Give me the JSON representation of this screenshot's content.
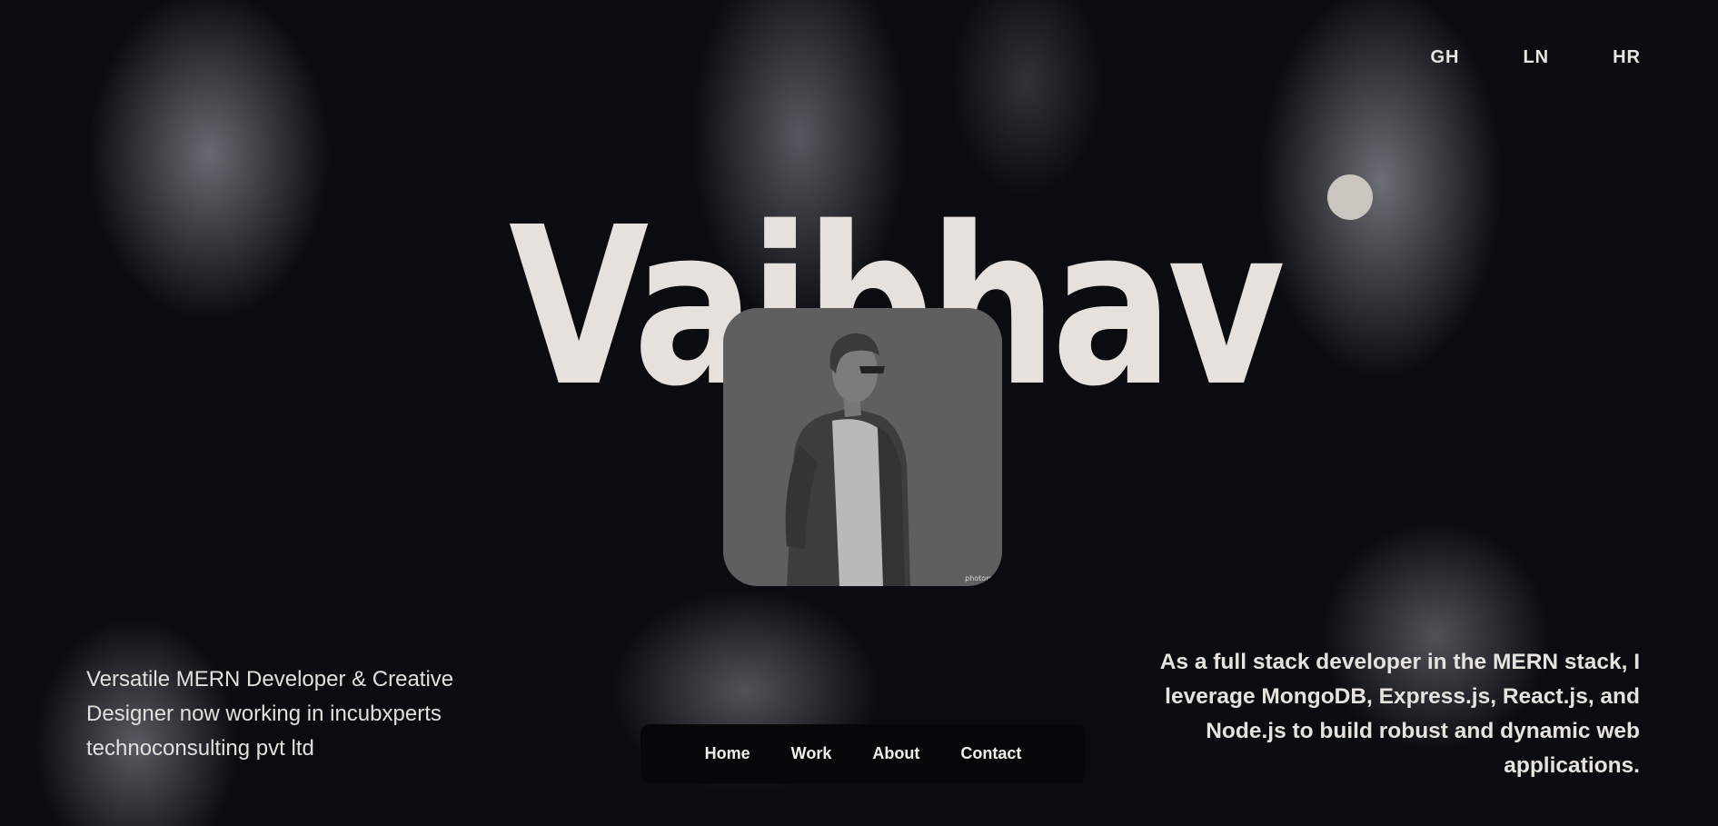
{
  "social_links": [
    "GH",
    "LN",
    "HR"
  ],
  "hero": {
    "name": "Vaibhav"
  },
  "portrait": {
    "watermark": "photom"
  },
  "left_tagline": "Versatile MERN Developer & Creative Designer now working in incubxperts technoconsulting pvt ltd",
  "right_text": "As a full stack developer in the MERN stack, I leverage MongoDB, Express.js, React.js, and Node.js to build robust and dynamic web applications.",
  "nav": {
    "items": [
      "Home",
      "Work",
      "About",
      "Contact"
    ]
  },
  "colors": {
    "background": "#0b0c10",
    "text": "#e6e1dc",
    "nav_bg": "#070709",
    "portrait_bg": "#5f5f5f",
    "dot": "#c9c6c0"
  }
}
